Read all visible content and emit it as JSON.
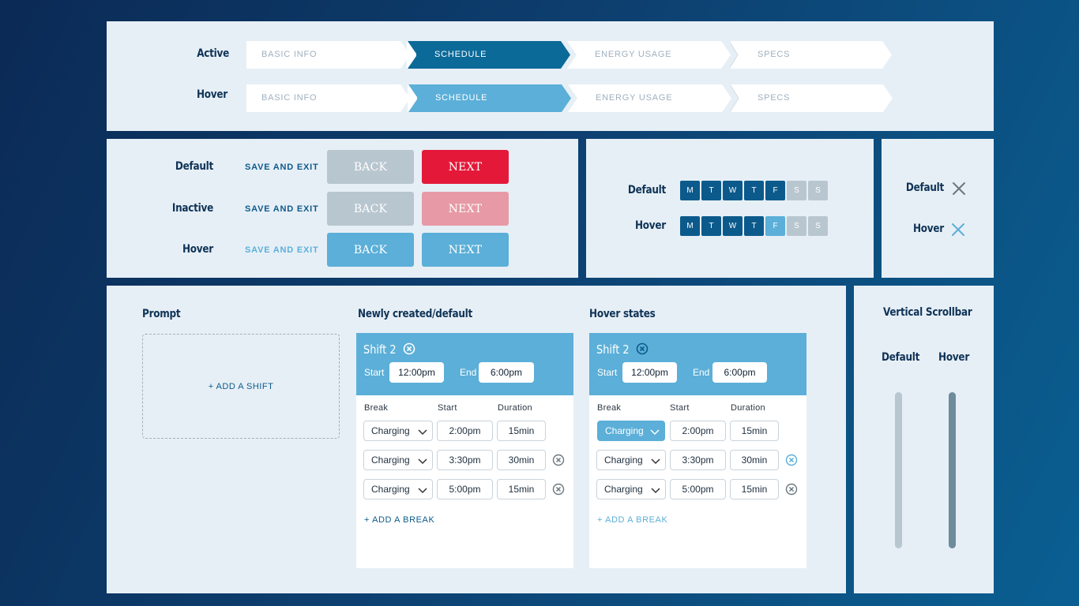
{
  "stepper": {
    "rows": [
      {
        "label": "Active",
        "steps": [
          "BASIC INFO",
          "SCHEDULE",
          "ENERGY USAGE",
          "SPECS"
        ],
        "active_index": 1,
        "active_color": "#0c6a99"
      },
      {
        "label": "Hover",
        "steps": [
          "BASIC INFO",
          "SCHEDULE",
          "ENERGY USAGE",
          "SPECS"
        ],
        "active_index": 1,
        "active_color": "#5bafd8"
      }
    ]
  },
  "buttons": {
    "rows": [
      {
        "label": "Default",
        "save_exit": "SAVE AND EXIT",
        "back": "BACK",
        "next": "NEXT"
      },
      {
        "label": "Inactive",
        "save_exit": "SAVE AND EXIT",
        "back": "BACK",
        "next": "NEXT"
      },
      {
        "label": "Hover",
        "save_exit": "SAVE AND EXIT",
        "back": "BACK",
        "next": "NEXT"
      }
    ],
    "colors": {
      "back_default": "#b8c6cf",
      "next_default": "#e4193a",
      "next_inactive": "#e79aa6",
      "hover": "#5bafd8",
      "link": "#0c5a8c",
      "link_hover": "#5bafd8"
    }
  },
  "days": {
    "rows": [
      {
        "label": "Default",
        "letters": [
          "M",
          "T",
          "W",
          "T",
          "F",
          "S",
          "S"
        ]
      },
      {
        "label": "Hover",
        "letters": [
          "M",
          "T",
          "W",
          "T",
          "F",
          "S",
          "S"
        ]
      }
    ],
    "colors": {
      "selected": "#0c5a8c",
      "hover": "#5bafd8",
      "disabled": "#b8c6cf"
    }
  },
  "close_icons": {
    "default_label": "Default",
    "hover_label": "Hover",
    "default_color": "#6b7780",
    "hover_color": "#5bafd8"
  },
  "shifts": {
    "prompt_title": "Prompt",
    "add_shift": "+ ADD A SHIFT",
    "default_title": "Newly created/default",
    "hover_title": "Hover states",
    "card": {
      "name": "Shift 2",
      "start_label": "Start",
      "start_value": "12:00pm",
      "end_label": "End",
      "end_value": "6:00pm",
      "col_break": "Break",
      "col_start": "Start",
      "col_duration": "Duration",
      "breaks": [
        {
          "type": "Charging",
          "start": "2:00pm",
          "duration": "15min"
        },
        {
          "type": "Charging",
          "start": "3:30pm",
          "duration": "30min"
        },
        {
          "type": "Charging",
          "start": "5:00pm",
          "duration": "15min"
        }
      ],
      "add_break": "+ ADD A BREAK"
    }
  },
  "scrollbar": {
    "title": "Vertical Scrollbar",
    "default_label": "Default",
    "hover_label": "Hover",
    "default_color": "#b8c6cf",
    "hover_color": "#6e8c9b"
  }
}
